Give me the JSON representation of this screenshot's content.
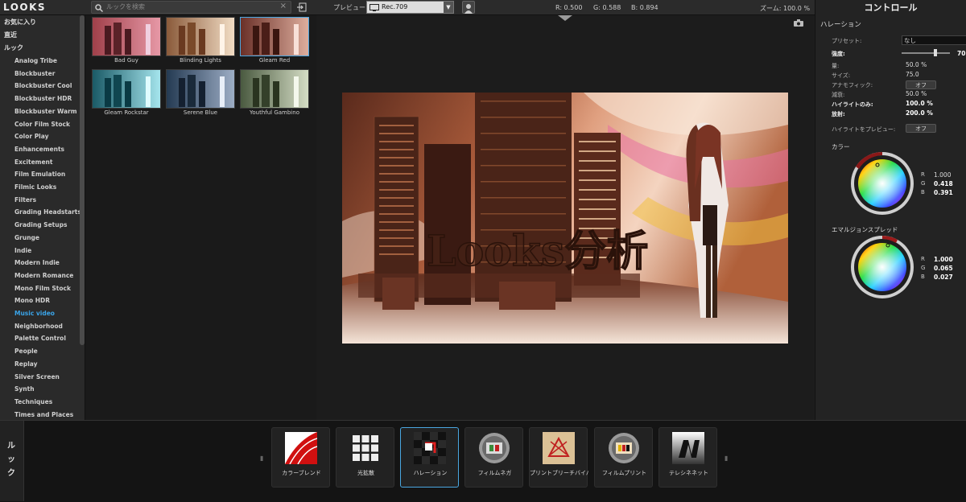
{
  "app": {
    "logo": "LOOKS"
  },
  "search": {
    "placeholder": "ルックを検索",
    "clear": "×"
  },
  "preview": {
    "label": "プレビュー：",
    "value": "Rec.709"
  },
  "readout": {
    "r": "R: 0.500",
    "g": "G: 0.588",
    "b": "B: 0.894",
    "zoom": "ズーム: 100.0 %"
  },
  "sidebar": {
    "headers": [
      "お気に入り",
      "直近",
      "ルック"
    ],
    "items": [
      "Analog Tribe",
      "Blockbuster",
      "Blockbuster Cool",
      "Blockbuster HDR",
      "Blockbuster Warm",
      "Color Film Stock",
      "Color Play",
      "Enhancements",
      "Excitement",
      "Film Emulation",
      "Filmic Looks",
      "Filters",
      "Grading Headstarts",
      "Grading Setups",
      "Grunge",
      "Indie",
      "Modern Indie",
      "Modern Romance",
      "Mono Film Stock",
      "Mono HDR",
      "Music video",
      "Neighborhood",
      "Palette Control",
      "People",
      "Replay",
      "Silver Screen",
      "Synth",
      "Techniques",
      "Times and Places"
    ],
    "active": "Music video"
  },
  "looks": [
    {
      "name": "Bad Guy",
      "color": "#b04a4a"
    },
    {
      "name": "Blinding Lights",
      "color": "#d9a27a"
    },
    {
      "name": "Gleam Red",
      "color": "#8c3a34"
    },
    {
      "name": "Gleam Rockstar",
      "color": "#2c8a96"
    },
    {
      "name": "Serene Blue",
      "color": "#3a5a7a"
    },
    {
      "name": "Youthful Gambino",
      "color": "#7a8a6a"
    }
  ],
  "selected_look": "Gleam Red",
  "image": {
    "overlay_text": "Looks分析"
  },
  "controls": {
    "title": "コントロール",
    "section": "ハレーション",
    "preset_label": "プリセット:",
    "preset_value": "なし",
    "strength_label": "強度:",
    "strength_value": "70.0",
    "strength_level": 0.7,
    "amount_label": "量:",
    "amount_value": "50.0",
    "size_label": "サイズ:",
    "size_value": "75.0",
    "anamorphic_label": "アナモフィック:",
    "anamorphic_value": "オフ",
    "decay_label": "減衰:",
    "decay_value": "50.0",
    "highlight_only_label": "ハイライトのみ:",
    "highlight_only_value": "100.0",
    "emission_label": "放射:",
    "emission_value": "200.0",
    "pct": "%",
    "preview_hl_label": "ハイライトをプレビュー:",
    "preview_hl_value": "オフ",
    "color_title": "カラー",
    "color": {
      "r_label": "R",
      "g_label": "G",
      "b_label": "B",
      "r": "1.000",
      "g": "0.418",
      "b": "0.391"
    },
    "emulsion_title": "エマルジョンスプレッド",
    "emulsion": {
      "r_label": "R",
      "g_label": "G",
      "b_label": "B",
      "r": "1.000",
      "g": "0.065",
      "b": "0.027"
    }
  },
  "bottom": {
    "tab": "ルック",
    "tools": [
      "カラーブレンド",
      "光拡散",
      "ハレーション",
      "フィルムネガ",
      "プリントブリーチバイパス",
      "フィルムプリント",
      "テレシネネット"
    ],
    "selected": "ハレーション"
  }
}
